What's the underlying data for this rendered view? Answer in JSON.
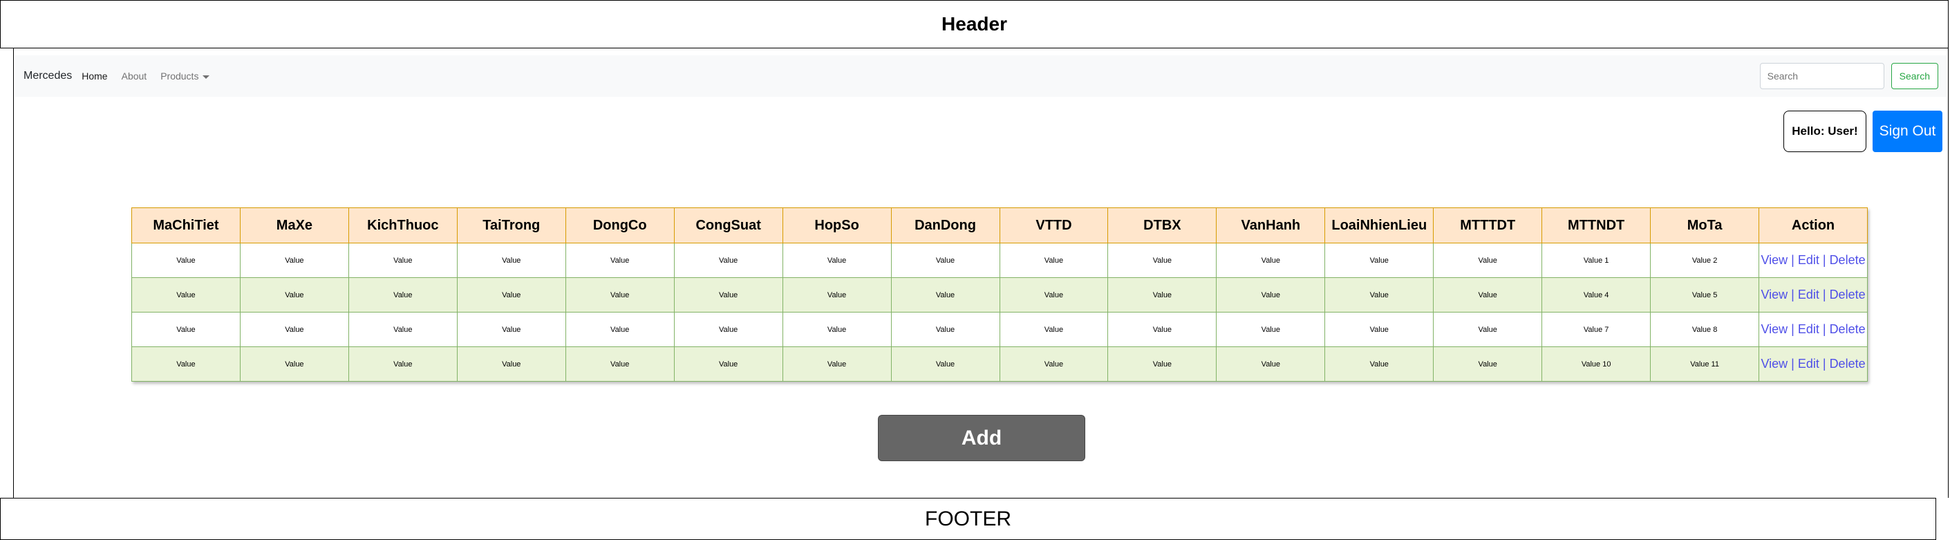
{
  "header": {
    "title": "Header"
  },
  "navbar": {
    "brand": "Mercedes",
    "links": [
      "Home",
      "About"
    ],
    "dropdown_label": "Products",
    "search_placeholder": "Search",
    "search_button": "Search"
  },
  "user": {
    "greeting": "Hello: User!",
    "sign_out": "Sign Out"
  },
  "table": {
    "columns": [
      "MaChiTiet",
      "MaXe",
      "KichThuoc",
      "TaiTrong",
      "DongCo",
      "CongSuat",
      "HopSo",
      "DanDong",
      "VTTD",
      "DTBX",
      "VanHanh",
      "LoaiNhienLieu",
      "MTTTDT",
      "MTTNDT",
      "MoTa",
      "Action"
    ],
    "rows": [
      [
        "Value",
        "Value",
        "Value",
        "Value",
        "Value",
        "Value",
        "Value",
        "Value",
        "Value",
        "Value",
        "Value",
        "Value",
        "Value",
        "Value 1",
        "Value 2"
      ],
      [
        "Value",
        "Value",
        "Value",
        "Value",
        "Value",
        "Value",
        "Value",
        "Value",
        "Value",
        "Value",
        "Value",
        "Value",
        "Value",
        "Value 4",
        "Value 5"
      ],
      [
        "Value",
        "Value",
        "Value",
        "Value",
        "Value",
        "Value",
        "Value",
        "Value",
        "Value",
        "Value",
        "Value",
        "Value",
        "Value",
        "Value 7",
        "Value 8"
      ],
      [
        "Value",
        "Value",
        "Value",
        "Value",
        "Value",
        "Value",
        "Value",
        "Value",
        "Value",
        "Value",
        "Value",
        "Value",
        "Value",
        "Value 10",
        "Value 11"
      ]
    ],
    "actions": {
      "view": "View",
      "edit": "Edit",
      "delete": "Delete",
      "separator": " | "
    }
  },
  "add_button": "Add",
  "footer": {
    "title": "FOOTER"
  },
  "colors": {
    "header_fill": "#ffe6cc",
    "header_border": "#d79b00",
    "row_alt_fill": "#eaf3d8",
    "row_border": "#82b366",
    "action_link": "#4f4fe8",
    "signout_bg": "#007bff",
    "search_green": "#28a745",
    "add_bg": "#666666"
  }
}
